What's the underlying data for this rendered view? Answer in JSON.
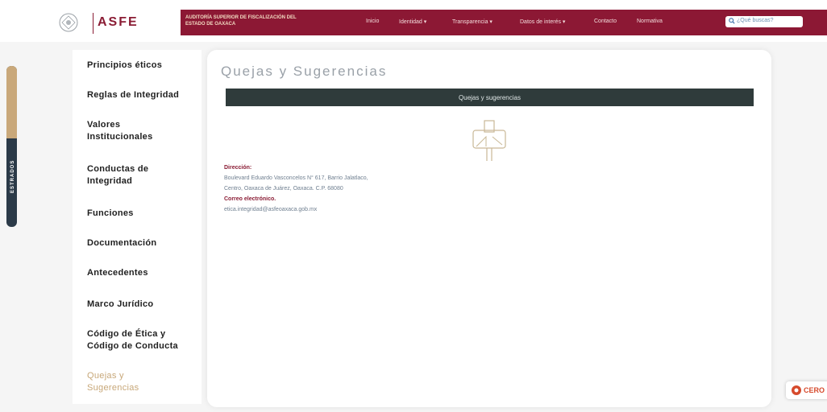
{
  "header": {
    "brand": "ASFE",
    "org_name": "AUDITORÍA SUPERIOR DE FISCALIZACIÓN DEL ESTADO DE OAXACA",
    "nav": [
      "Inicio",
      "Identidad ▾",
      "Transparencia ▾",
      "Datos de interés ▾",
      "Contacto",
      "Normativa"
    ],
    "search_placeholder": "¿Qué buscas?"
  },
  "edge_tab": {
    "label": "ESTRADOS"
  },
  "sidebar": {
    "items": [
      {
        "label": "Principios éticos"
      },
      {
        "label": "Reglas de Integridad"
      },
      {
        "label": "Valores Institucionales"
      },
      {
        "label": "Conductas de Integridad"
      },
      {
        "label": "Funciones"
      },
      {
        "label": "Documentación"
      },
      {
        "label": "Antecedentes"
      },
      {
        "label": "Marco Jurídico"
      },
      {
        "label": "Código de Ética y Código de Conducta"
      },
      {
        "label": "Quejas y Sugerencias"
      }
    ],
    "active_index": 9
  },
  "main": {
    "title": "Quejas y Sugerencias",
    "band_title": "Quejas y sugerencias",
    "address_label": "Dirección:",
    "address_line1": "Boulevard Eduardo Vasconcelos N° 617, Barrio Jalatlaco,",
    "address_line2": "Centro, Oaxaca de Juárez, Oaxaca. C.P. 68080",
    "email_label": "Correo electrónico.",
    "email": "etica.integridad@asfeoaxaca.gob.mx"
  },
  "badge": {
    "text": "CERO"
  },
  "colors": {
    "brand": "#8c1834",
    "band": "#2f3b3b",
    "active": "#c7a778"
  }
}
